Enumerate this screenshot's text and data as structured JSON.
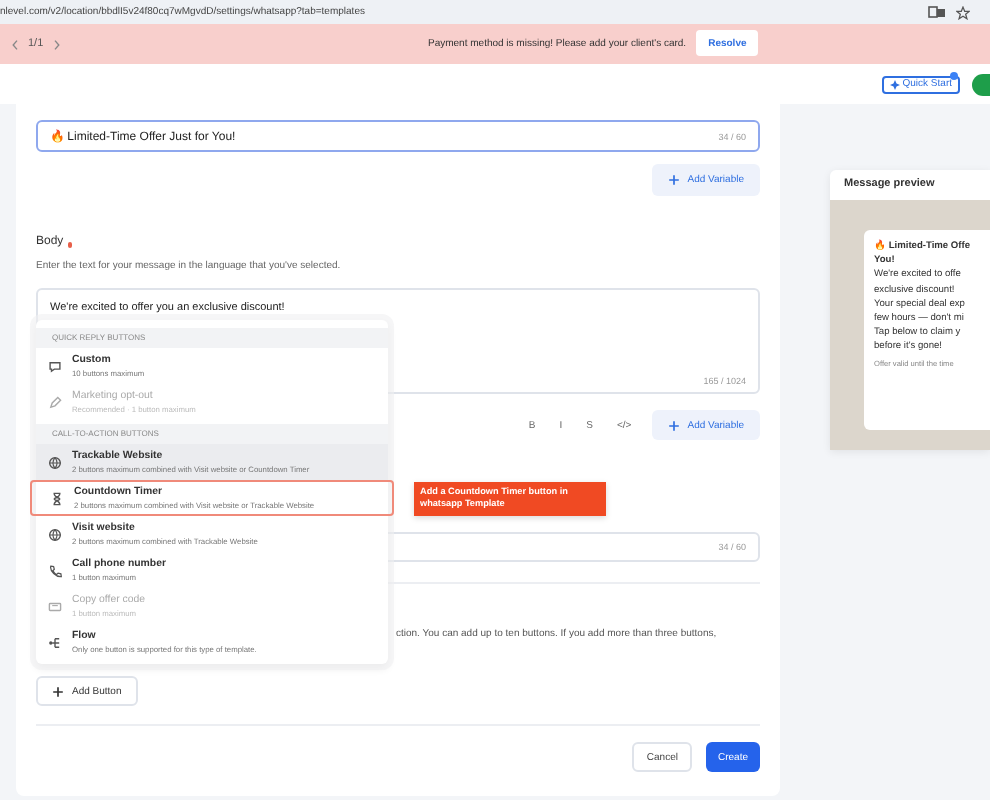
{
  "browser": {
    "url": "nlevel.com/v2/location/bbdlI5v24f80cq7wMgvdD/settings/whatsapp?tab=templates"
  },
  "banner": {
    "pager": "1/1",
    "message": "Payment method is missing! Please add your client's card.",
    "action": "Resolve"
  },
  "header": {
    "quick_start": "Quick Start"
  },
  "form": {
    "title_field": {
      "value": "🔥 Limited-Time Offer Just for You!",
      "counter": "34 / 60"
    },
    "title_add_variable": "Add Variable",
    "body_label": "Body",
    "body_required": true,
    "body_hint": "Enter the text for your message in the language that you've selected.",
    "body_field": {
      "value": "We're excited to offer you an exclusive discount!",
      "counter": "165 / 1024"
    },
    "format_buttons": [
      "B",
      "I",
      "S",
      "</>"
    ],
    "body_add_variable": "Add Variable",
    "footer_counter": "34 / 60",
    "buttons_hint": "ction. You can add up to ten buttons. If you add more than three buttons,",
    "add_button": "Add Button",
    "cancel": "Cancel",
    "create": "Create"
  },
  "menu": {
    "sections": [
      {
        "title": "QUICK REPLY BUTTONS",
        "items": [
          {
            "kind": "chat",
            "title": "Custom",
            "subtitle": "10 buttons maximum",
            "disabled": false,
            "hovered": false,
            "annotated": false
          },
          {
            "kind": "pencil",
            "title": "Marketing opt-out",
            "subtitle": "Recommended · 1 button maximum",
            "disabled": true,
            "hovered": false,
            "annotated": false
          }
        ]
      },
      {
        "title": "CALL-TO-ACTION BUTTONS",
        "items": [
          {
            "kind": "globe",
            "title": "Trackable Website",
            "subtitle": "2 buttons maximum combined with Visit website or Countdown Timer",
            "disabled": false,
            "hovered": true,
            "annotated": false
          },
          {
            "kind": "hourglass",
            "title": "Countdown Timer",
            "subtitle": "2 buttons maximum combined with Visit website or Trackable Website",
            "disabled": false,
            "hovered": false,
            "annotated": true
          },
          {
            "kind": "globe",
            "title": "Visit website",
            "subtitle": "2 buttons maximum combined with Trackable Website",
            "disabled": false,
            "hovered": false,
            "annotated": false
          },
          {
            "kind": "phone",
            "title": "Call phone number",
            "subtitle": "1 button maximum",
            "disabled": false,
            "hovered": false,
            "annotated": false
          },
          {
            "kind": "ticket",
            "title": "Copy offer code",
            "subtitle": "1 button maximum",
            "disabled": true,
            "hovered": false,
            "annotated": false
          },
          {
            "kind": "flow",
            "title": "Flow",
            "subtitle": "Only one button is supported for this type of template.",
            "disabled": false,
            "hovered": false,
            "annotated": false
          }
        ]
      }
    ]
  },
  "callout": "Add a Countdown Timer button in whatsapp Template",
  "preview": {
    "title": "Message preview",
    "heading": [
      "🔥 Limited-Time Offe",
      "You!"
    ],
    "lines": [
      "We're excited to offe",
      "exclusive discount!",
      "Your special deal exp",
      "few hours — don't mi",
      "Tap below to claim y",
      "before it's gone!"
    ],
    "note": "Offer valid until the time"
  }
}
